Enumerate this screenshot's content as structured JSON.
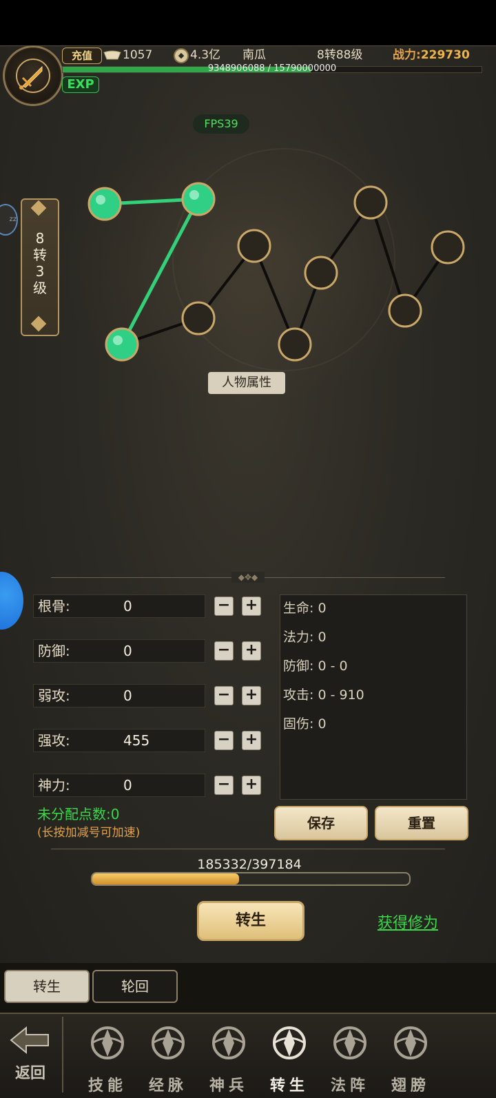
{
  "header": {
    "recharge_label": "充值",
    "ingots": "1057",
    "coins": "4.3亿",
    "player_name": "南瓜",
    "rebirth_level": "8转88级",
    "power_label": "战力:",
    "power_value": "229730",
    "exp_badge": "EXP",
    "exp_text": "9348906088 / 15790000000",
    "exp_progress": 0.592
  },
  "fps": "FPS39",
  "side_level": "8\n转\n3\n级",
  "bubble_text": "zz",
  "attr_tag": "人物属性",
  "stats": [
    {
      "name": "根骨:",
      "value": "0"
    },
    {
      "name": "防御:",
      "value": "0"
    },
    {
      "name": "弱攻:",
      "value": "0"
    },
    {
      "name": "强攻:",
      "value": "455"
    },
    {
      "name": "神力:",
      "value": "0"
    }
  ],
  "minus_symbol": "−",
  "plus_symbol": "+",
  "attributes": [
    "生命: 0",
    "法力: 0",
    "防御: 0 - 0",
    "攻击: 0 - 910",
    "固伤: 0"
  ],
  "unallocated": "未分配点数:0",
  "hint": "(长按加减号可加速)",
  "save_label": "保存",
  "reset_label": "重置",
  "progress_text": "185332/397184",
  "progress_ratio": 0.4666,
  "rebirth_button": "转生",
  "gain_link": "获得修为",
  "tabs": [
    {
      "label": "转生",
      "active": true
    },
    {
      "label": "轮回",
      "active": false
    }
  ],
  "back_label": "返回",
  "nav": [
    {
      "label": "技能",
      "icon": "skill-icon"
    },
    {
      "label": "经脉",
      "icon": "meridian-icon"
    },
    {
      "label": "神兵",
      "icon": "weapon-icon"
    },
    {
      "label": "转生",
      "icon": "rebirth-icon",
      "active": true
    },
    {
      "label": "法阵",
      "icon": "formation-icon"
    },
    {
      "label": "翅膀",
      "icon": "wings-icon"
    }
  ],
  "colors": {
    "active_node": "#2fcf86",
    "inactive_node": "#2a251d",
    "node_border": "#c9a869",
    "active_line": "#33d17a",
    "inactive_line": "#0e0d0b",
    "green_text": "#3ad84a",
    "gold_text": "#e3a34a"
  }
}
